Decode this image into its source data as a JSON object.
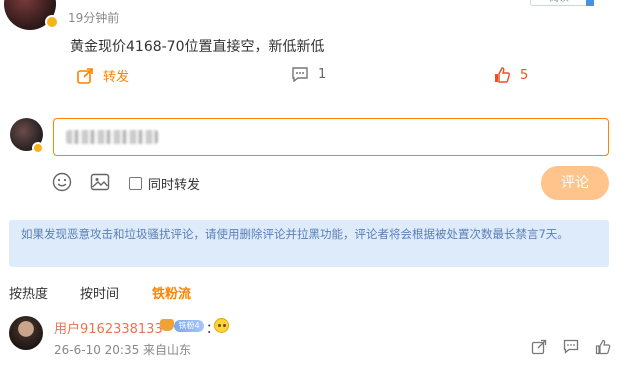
{
  "top": {
    "time": "19分钟前",
    "button_label": "阅读"
  },
  "post": {
    "content": "黄金现价4168-70位置直接空，新低新低",
    "actions": {
      "repost_label": "转发",
      "comment_count": "1",
      "like_count": "5"
    }
  },
  "composer": {
    "input_value": "",
    "sync_repost_label": "同时转发",
    "submit_label": "评论"
  },
  "notice": {
    "text": "如果发现恶意攻击和垃圾骚扰评论，请使用删除评论并拉黑功能，评论者将会根据被处置次数最长禁言7天。"
  },
  "sort_tabs": [
    "按热度",
    "按时间",
    "铁粉流"
  ],
  "comment": {
    "username": "用户9162338133",
    "fan_badge": "铁粉4",
    "colon": "：",
    "meta": "26-6-10 20:35 来自山东"
  },
  "icons": {
    "repost": "share-icon",
    "comment": "comment-icon",
    "like": "thumb-up-icon",
    "emoji": "emoji-icon",
    "image": "image-icon"
  },
  "colors": {
    "accent": "#ff8200",
    "like": "#f04e23",
    "notice_bg": "#ddebfb",
    "notice_text": "#5b7fb5",
    "submit_bg": "#ffc38c"
  }
}
